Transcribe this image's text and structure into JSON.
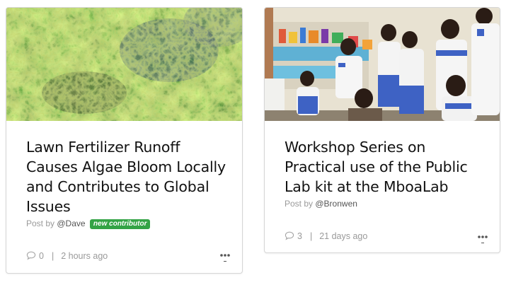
{
  "cards": [
    {
      "image": "aerial-vegetation-photo",
      "title": "Lawn Fertilizer Runoff Causes Algae Bloom Locally and Contributes to Global Issues",
      "post_by_label": "Post by",
      "author": "@Dave",
      "badge": "new contributor",
      "comment_count": "0",
      "time": "2 hours ago"
    },
    {
      "image": "classroom-children-photo",
      "title": "Workshop Series on Practical use of the Public Lab kit at the MboaLab",
      "post_by_label": "Post by",
      "author": "@Bronwen",
      "comment_count": "3",
      "time": "21 days ago"
    }
  ],
  "colors": {
    "badge": "#33a345",
    "border": "#d6d6d6",
    "muted_text": "#9a9a9a",
    "title_text": "#111111"
  },
  "icons": {
    "comment": "speech-bubble-icon",
    "more": "ellipsis-icon"
  },
  "separator": "|"
}
